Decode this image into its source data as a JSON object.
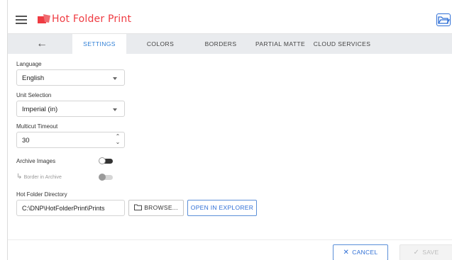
{
  "header": {
    "app_title": "Hot Folder Print",
    "menu_icon": "hamburger-menu-icon",
    "logo_icon": "printer-logo-icon",
    "folder_icon": "folder-open-icon",
    "brand_color": "#ef3b42",
    "accent_color": "#2f7fd6"
  },
  "tabs": [
    {
      "label": "SETTINGS",
      "active": true
    },
    {
      "label": "COLORS",
      "active": false
    },
    {
      "label": "BORDERS",
      "active": false
    },
    {
      "label": "PARTIAL MATTE",
      "active": false
    },
    {
      "label": "CLOUD SERVICES",
      "active": false
    }
  ],
  "back_icon": "arrow-left-icon",
  "settings": {
    "language": {
      "label": "Language",
      "value": "English"
    },
    "unit": {
      "label": "Unit Selection",
      "value": "Imperial (in)"
    },
    "timeout": {
      "label": "Multicut Timeout",
      "value": "30"
    },
    "archive_images": {
      "label": "Archive Images",
      "on": false
    },
    "border_in_archive": {
      "label": "Border in Archive",
      "on": false,
      "disabled": true
    },
    "hot_folder": {
      "label": "Hot Folder Directory",
      "value": "C:\\DNP\\HotFolderPrint\\Prints",
      "browse_label": "BROWSE...",
      "explorer_label": "OPEN IN EXPLORER"
    }
  },
  "footer": {
    "cancel_label": "CANCEL",
    "save_label": "SAVE"
  }
}
